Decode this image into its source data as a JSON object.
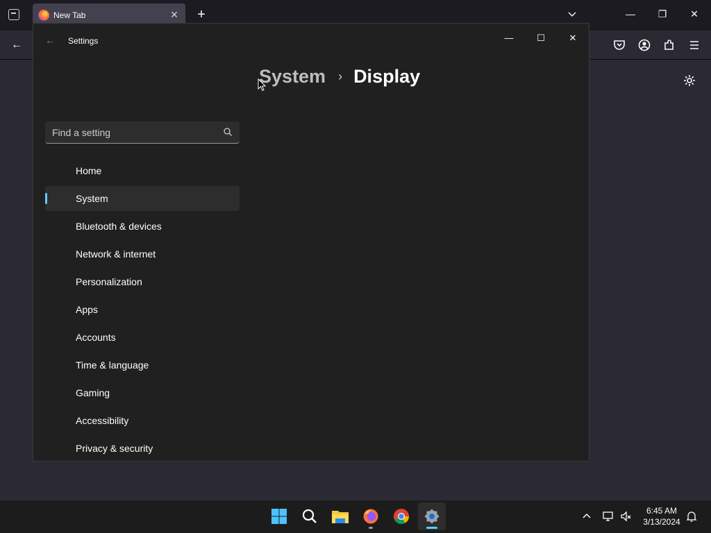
{
  "browser": {
    "tab_title": "New Tab",
    "new_tab_symbol": "+"
  },
  "settings": {
    "app_title": "Settings",
    "breadcrumb": {
      "parent": "System",
      "separator": "›",
      "current": "Display"
    },
    "search": {
      "placeholder": "Find a setting",
      "value": ""
    },
    "nav": [
      {
        "label": "Home",
        "active": false
      },
      {
        "label": "System",
        "active": true
      },
      {
        "label": "Bluetooth & devices",
        "active": false
      },
      {
        "label": "Network & internet",
        "active": false
      },
      {
        "label": "Personalization",
        "active": false
      },
      {
        "label": "Apps",
        "active": false
      },
      {
        "label": "Accounts",
        "active": false
      },
      {
        "label": "Time & language",
        "active": false
      },
      {
        "label": "Gaming",
        "active": false
      },
      {
        "label": "Accessibility",
        "active": false
      },
      {
        "label": "Privacy & security",
        "active": false
      }
    ]
  },
  "taskbar": {
    "apps": [
      "start-icon",
      "search-icon",
      "file-explorer-icon",
      "firefox-icon",
      "chrome-icon",
      "settings-icon"
    ],
    "clock": {
      "time": "6:45 AM",
      "date": "3/13/2024"
    }
  },
  "colors": {
    "accent": "#60cdff",
    "settings_bg": "#202020",
    "browser_bg": "#2b2a33"
  }
}
